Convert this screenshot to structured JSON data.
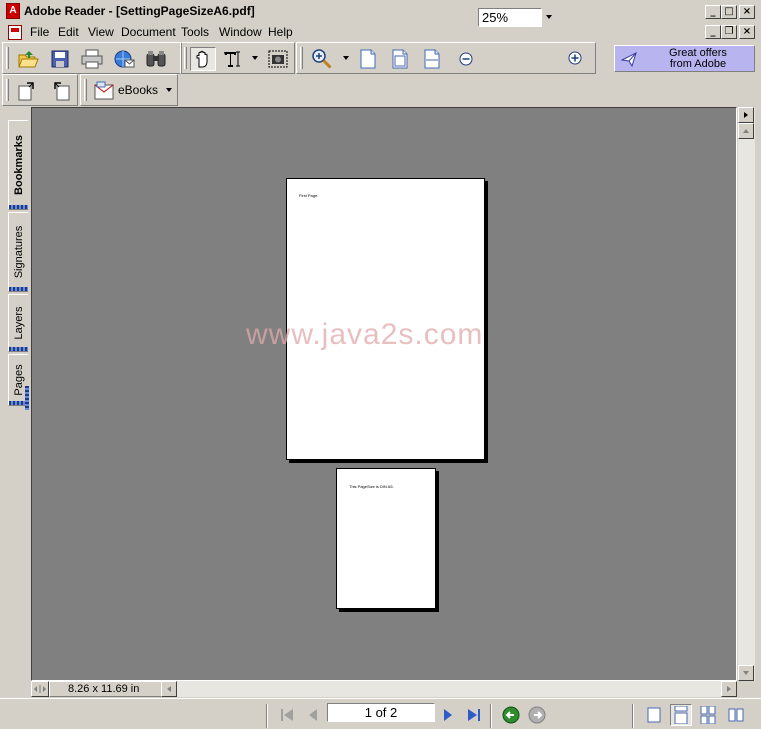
{
  "window": {
    "title": "Adobe Reader - [SettingPageSizeA6.pdf]",
    "app_icon_glyph": "A",
    "caption_min": "_",
    "caption_max": "□",
    "caption_close": "×",
    "doc_caption_min": "_",
    "doc_caption_restore": "❐",
    "doc_caption_close": "×"
  },
  "menubar": {
    "items": [
      "File",
      "Edit",
      "View",
      "Document",
      "Tools",
      "Window",
      "Help"
    ]
  },
  "toolbar": {
    "zoom_value": "25%",
    "ebooks_label": "eBooks",
    "offer_text_line1": "Great offers",
    "offer_text_line2": "from Adobe"
  },
  "navtabs": {
    "bookmarks": "Bookmarks",
    "signatures": "Signatures",
    "layers": "Layers",
    "pages": "Pages"
  },
  "document": {
    "page1_text": "First Page.",
    "page2_text": "This PageSize is DIN A5.",
    "watermark": "www.java2s.com"
  },
  "status": {
    "page_size": "8.26 x 11.69 in",
    "page_indicator": "1 of 2"
  },
  "colors": {
    "doc_background": "#808080",
    "offer_background": "#b8b4f0",
    "watermark_color": "#e0aaaa",
    "nav_green": "#2e8b2e"
  }
}
